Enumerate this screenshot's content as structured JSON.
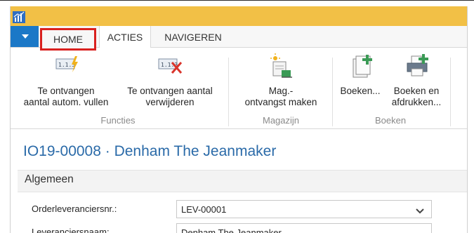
{
  "tabs": {
    "home": "HOME",
    "acties": "ACTIES",
    "navigeren": "NAVIGEREN"
  },
  "ribbon": {
    "functies": {
      "label": "Functies",
      "auto_fill_line1": "Te ontvangen",
      "auto_fill_line2": "aantal autom. vullen",
      "delete_line1": "Te ontvangen aantal",
      "delete_line2": "verwijderen"
    },
    "magazijn": {
      "label": "Magazijn",
      "receipt_line1": "Mag.-",
      "receipt_line2": "ontvangst maken"
    },
    "boeken": {
      "label": "Boeken",
      "post_label": "Boeken...",
      "post_print_line1": "Boeken en",
      "post_print_line2": "afdrukken..."
    }
  },
  "page": {
    "title": "IO19-00008 · Denham The Jeanmaker"
  },
  "section": {
    "title": "Algemeen"
  },
  "fields": {
    "vendor_no_label": "Orderleveranciersnr.:",
    "vendor_no_value": "LEV-00001",
    "vendor_name_label": "Leveranciersnaam:",
    "vendor_name_value": "Denham The Jeanmaker"
  },
  "colors": {
    "titlebar": "#f2c046",
    "menu_button": "#1b78c7",
    "highlight_border": "#d9211f",
    "title_text": "#2a6aa8"
  },
  "icons": {
    "app": "app-icon",
    "menu": "chevron-down-icon",
    "auto_fill": "fill-quantity-icon",
    "delete": "delete-quantity-icon",
    "receipt": "warehouse-receipt-icon",
    "post": "post-icon",
    "post_print": "post-print-icon"
  }
}
